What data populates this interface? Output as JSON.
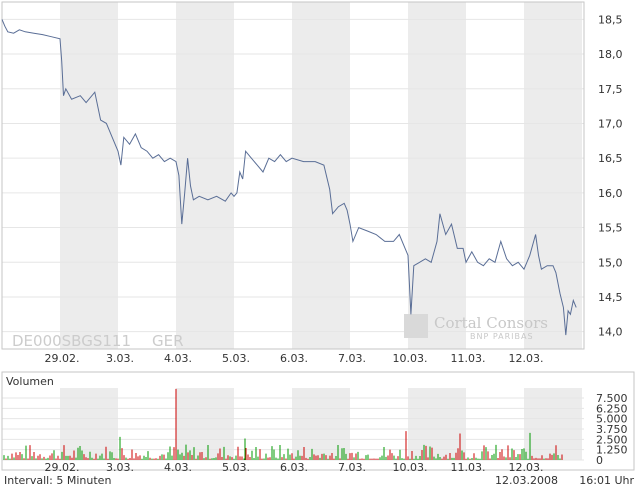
{
  "chart_data": {
    "type": "line",
    "title": "",
    "security": "DE000SBGS111",
    "exchange": "GER",
    "brand": {
      "name": "Cortal Consors",
      "subname": "BNP PARIBAS"
    },
    "dates": [
      "29.02.",
      "3.03.",
      "4.03.",
      "5.03.",
      "6.03.",
      "7.03.",
      "10.03.",
      "11.03.",
      "12.03."
    ],
    "ylim": [
      13.75,
      18.75
    ],
    "yticks": [
      "18,5",
      "18,0",
      "17,5",
      "17,0",
      "16,5",
      "16,0",
      "15,5",
      "15,0",
      "14,5",
      "14,0"
    ],
    "series": [
      {
        "values": [
          [
            0.0,
            18.5
          ],
          [
            0.05,
            18.4
          ],
          [
            0.1,
            18.32
          ],
          [
            0.2,
            18.3
          ],
          [
            0.3,
            18.35
          ],
          [
            0.4,
            18.32
          ],
          [
            0.55,
            18.3
          ],
          [
            0.7,
            18.28
          ],
          [
            0.85,
            18.25
          ],
          [
            1.0,
            18.22
          ],
          [
            1.03,
            17.9
          ],
          [
            1.06,
            17.4
          ],
          [
            1.1,
            17.5
          ],
          [
            1.2,
            17.35
          ],
          [
            1.35,
            17.4
          ],
          [
            1.45,
            17.3
          ],
          [
            1.6,
            17.45
          ],
          [
            1.7,
            17.05
          ],
          [
            1.8,
            17.0
          ],
          [
            1.9,
            16.8
          ],
          [
            2.0,
            16.6
          ],
          [
            2.05,
            16.4
          ],
          [
            2.1,
            16.8
          ],
          [
            2.2,
            16.7
          ],
          [
            2.3,
            16.85
          ],
          [
            2.4,
            16.65
          ],
          [
            2.5,
            16.6
          ],
          [
            2.6,
            16.5
          ],
          [
            2.7,
            16.55
          ],
          [
            2.8,
            16.45
          ],
          [
            2.9,
            16.5
          ],
          [
            3.0,
            16.45
          ],
          [
            3.05,
            16.25
          ],
          [
            3.1,
            15.55
          ],
          [
            3.15,
            16.0
          ],
          [
            3.2,
            16.5
          ],
          [
            3.25,
            16.1
          ],
          [
            3.3,
            15.9
          ],
          [
            3.4,
            15.95
          ],
          [
            3.55,
            15.9
          ],
          [
            3.7,
            15.95
          ],
          [
            3.85,
            15.88
          ],
          [
            3.95,
            16.0
          ],
          [
            4.0,
            15.95
          ],
          [
            4.05,
            16.0
          ],
          [
            4.1,
            16.3
          ],
          [
            4.15,
            16.2
          ],
          [
            4.2,
            16.6
          ],
          [
            4.3,
            16.5
          ],
          [
            4.4,
            16.4
          ],
          [
            4.5,
            16.3
          ],
          [
            4.6,
            16.5
          ],
          [
            4.7,
            16.45
          ],
          [
            4.8,
            16.55
          ],
          [
            4.9,
            16.45
          ],
          [
            5.0,
            16.5
          ],
          [
            5.2,
            16.45
          ],
          [
            5.4,
            16.45
          ],
          [
            5.55,
            16.4
          ],
          [
            5.65,
            16.05
          ],
          [
            5.7,
            15.7
          ],
          [
            5.8,
            15.8
          ],
          [
            5.9,
            15.85
          ],
          [
            5.95,
            15.75
          ],
          [
            6.0,
            15.55
          ],
          [
            6.05,
            15.3
          ],
          [
            6.15,
            15.5
          ],
          [
            6.3,
            15.45
          ],
          [
            6.45,
            15.4
          ],
          [
            6.6,
            15.3
          ],
          [
            6.75,
            15.3
          ],
          [
            6.85,
            15.4
          ],
          [
            6.95,
            15.2
          ],
          [
            7.0,
            15.1
          ],
          [
            7.05,
            14.25
          ],
          [
            7.1,
            14.95
          ],
          [
            7.2,
            15.0
          ],
          [
            7.3,
            15.05
          ],
          [
            7.4,
            15.0
          ],
          [
            7.5,
            15.3
          ],
          [
            7.55,
            15.7
          ],
          [
            7.65,
            15.4
          ],
          [
            7.75,
            15.55
          ],
          [
            7.85,
            15.2
          ],
          [
            7.95,
            15.2
          ],
          [
            8.0,
            15.0
          ],
          [
            8.1,
            15.15
          ],
          [
            8.2,
            15.0
          ],
          [
            8.3,
            14.95
          ],
          [
            8.4,
            15.05
          ],
          [
            8.5,
            15.0
          ],
          [
            8.55,
            15.15
          ],
          [
            8.6,
            15.3
          ],
          [
            8.7,
            15.05
          ],
          [
            8.8,
            14.95
          ],
          [
            8.9,
            15.0
          ],
          [
            9.0,
            14.9
          ],
          [
            9.1,
            15.1
          ],
          [
            9.2,
            15.4
          ],
          [
            9.25,
            15.1
          ],
          [
            9.3,
            14.9
          ],
          [
            9.4,
            14.95
          ],
          [
            9.5,
            14.95
          ],
          [
            9.55,
            14.85
          ],
          [
            9.62,
            14.55
          ],
          [
            9.68,
            14.35
          ],
          [
            9.72,
            13.95
          ],
          [
            9.76,
            14.3
          ],
          [
            9.8,
            14.25
          ],
          [
            9.85,
            14.45
          ],
          [
            9.9,
            14.35
          ]
        ]
      }
    ],
    "volume": {
      "label": "Volumen",
      "ylim": [
        0,
        9000
      ],
      "yticks": [
        "7.500",
        "6.250",
        "5.000",
        "3.750",
        "2.500",
        "1.250",
        "0"
      ]
    },
    "interval": "Intervall: 5 Minuten",
    "date": "12.03.2008",
    "time": "16:01 Uhr",
    "colors": {
      "line": "#5a6e96",
      "band": "#ececec",
      "grid": "#e6e6e6",
      "border": "#c6c6c6",
      "vol_up": "#009900",
      "vol_down": "#cc0000"
    }
  }
}
